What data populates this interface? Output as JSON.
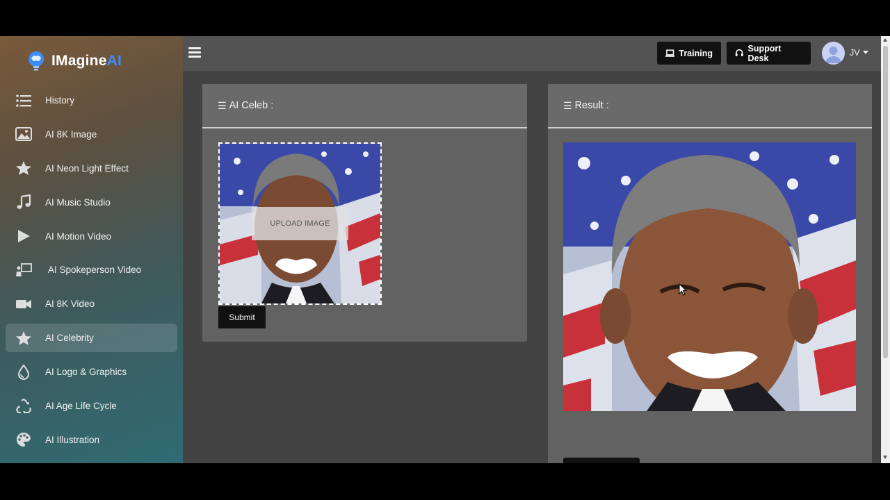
{
  "app": {
    "brand_main": "IMagine",
    "brand_accent": "AI"
  },
  "sidebar": {
    "items": [
      {
        "label": "History",
        "icon": "list-icon"
      },
      {
        "label": "AI 8K Image",
        "icon": "image-icon"
      },
      {
        "label": "AI Neon Light Effect",
        "icon": "star-icon"
      },
      {
        "label": "AI Music Studio",
        "icon": "music-note-icon"
      },
      {
        "label": "AI Motion Video",
        "icon": "play-icon"
      },
      {
        "label": "AI Spokeperson Video",
        "icon": "presenter-icon"
      },
      {
        "label": "AI 8K Video",
        "icon": "video-camera-icon"
      },
      {
        "label": "AI Celebrity",
        "icon": "star-icon",
        "active": true
      },
      {
        "label": "AI Logo & Graphics",
        "icon": "droplet-icon"
      },
      {
        "label": "AI Age Life Cycle",
        "icon": "recycle-icon"
      },
      {
        "label": "AI Illustration",
        "icon": "palette-icon"
      }
    ]
  },
  "topbar": {
    "training_label": "Training",
    "support_label": "Support Desk",
    "user_initials": "JV"
  },
  "left_card": {
    "title": "AI Celeb :",
    "upload_label": "UPLOAD IMAGE",
    "submit_label": "Submit"
  },
  "right_card": {
    "title": "Result :"
  },
  "colors": {
    "brand_accent": "#3d8cff",
    "button_dark": "#111111",
    "card_bg": "#626262",
    "page_bg": "#434343"
  }
}
